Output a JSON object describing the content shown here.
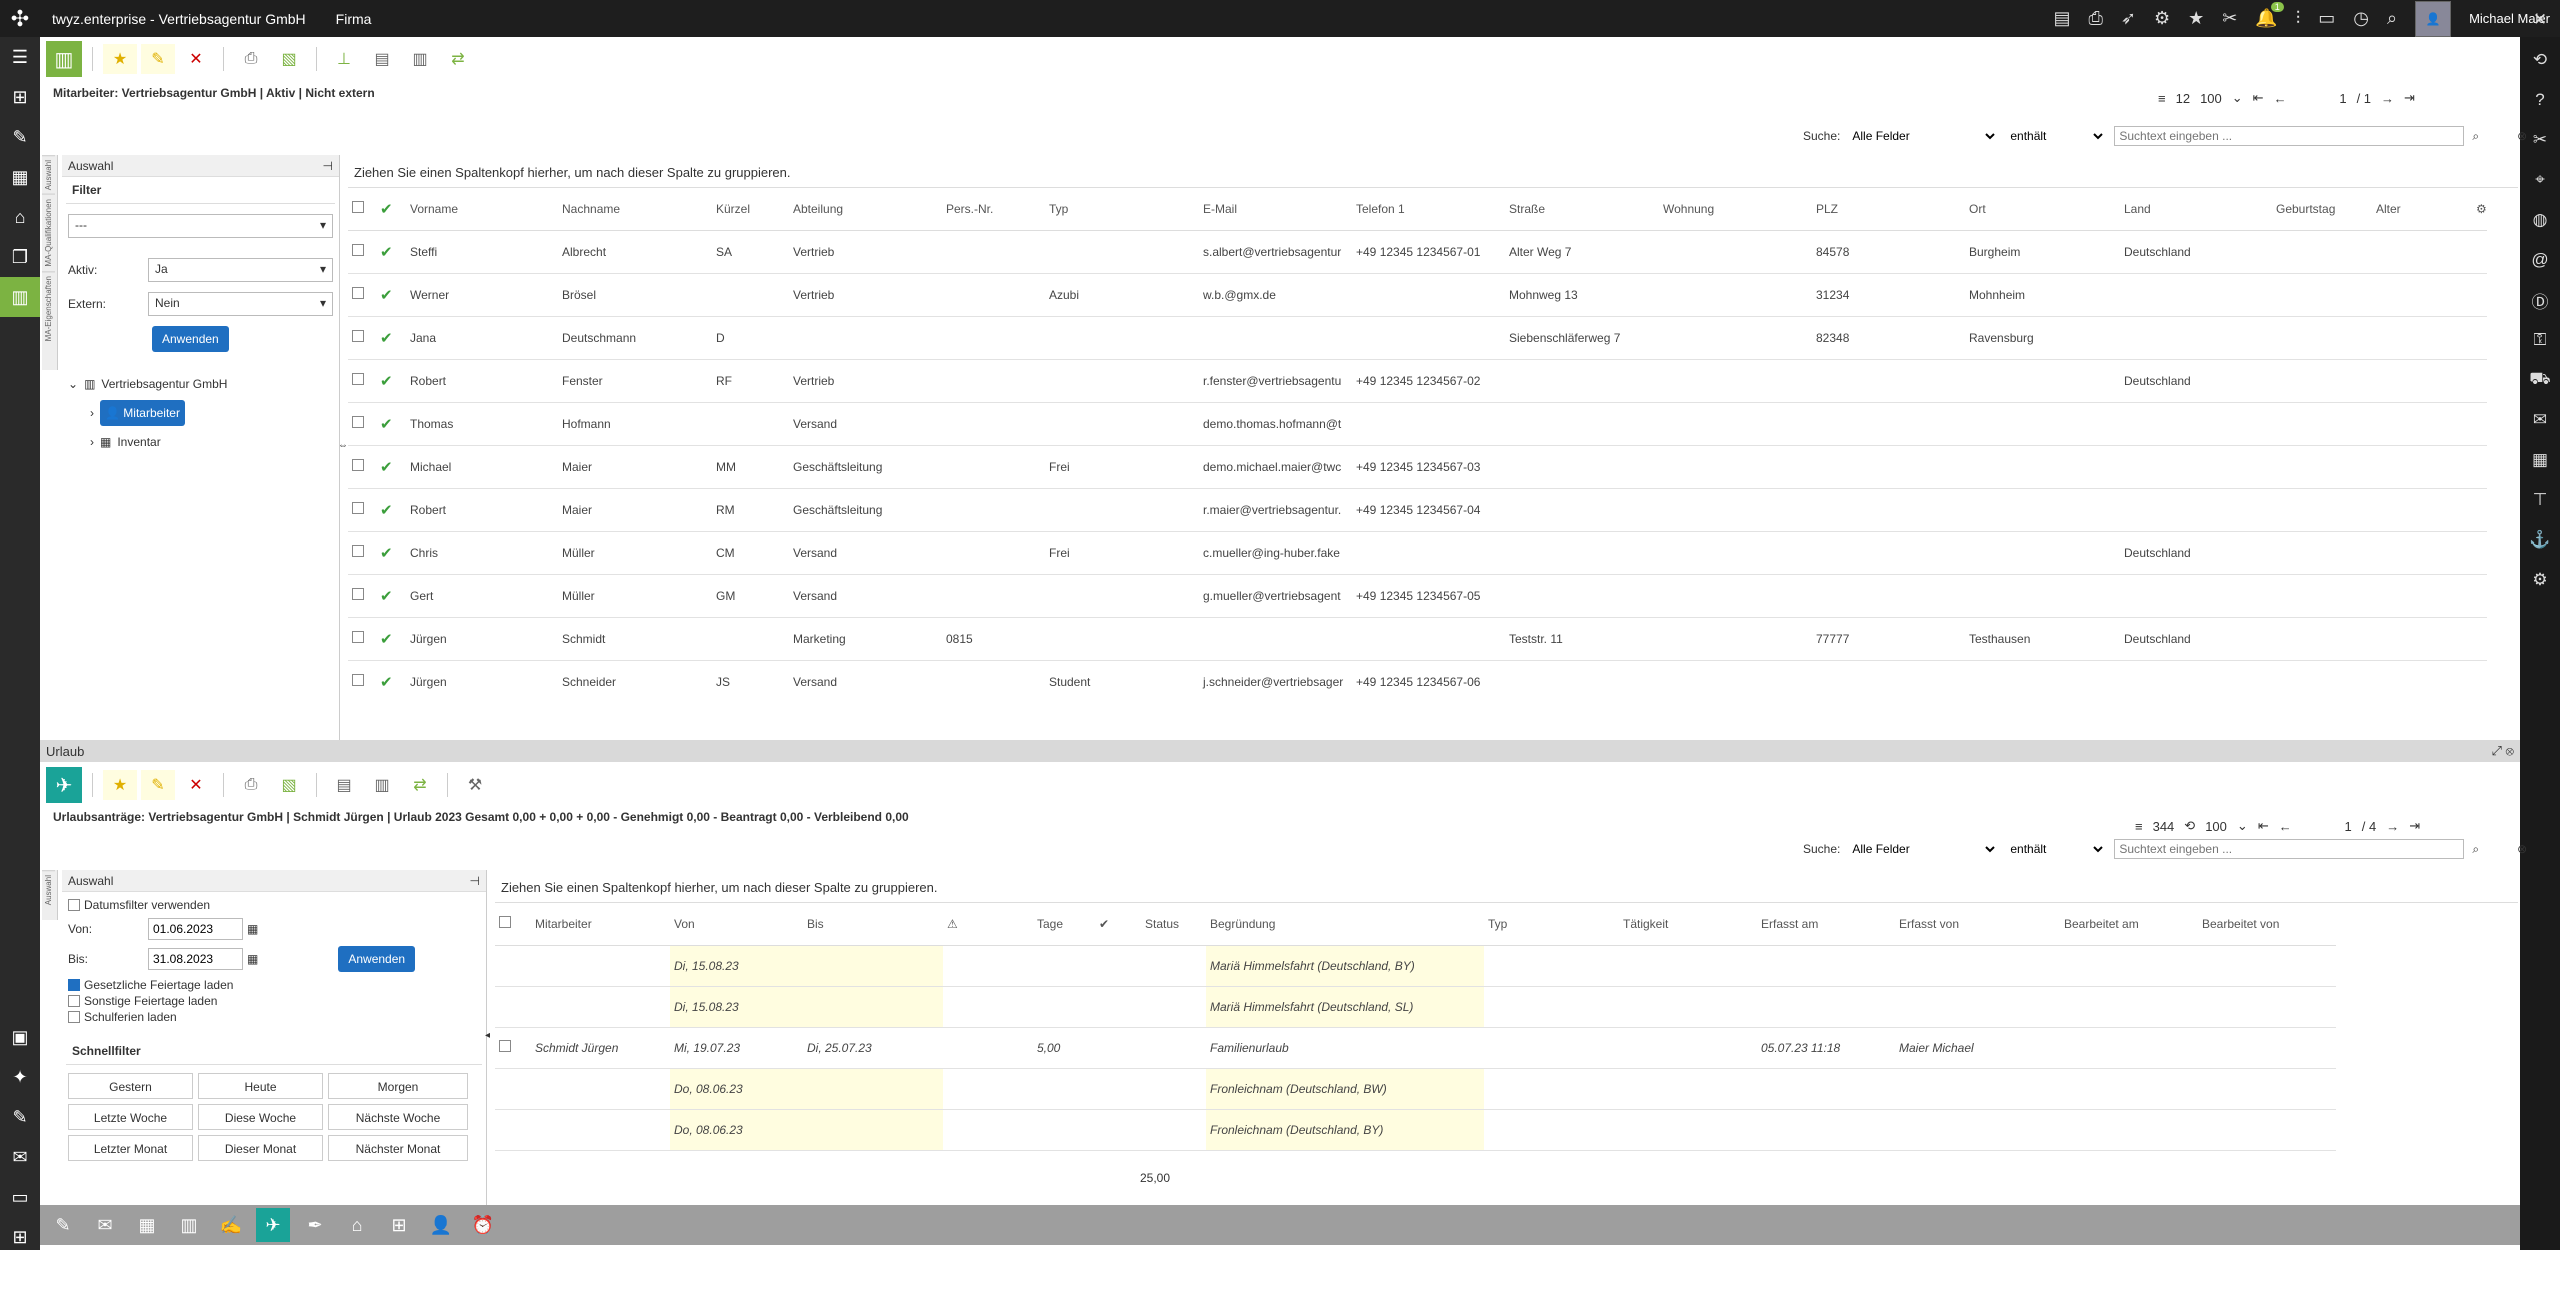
{
  "app": {
    "title": "twyz.enterprise - Vertriebsagentur GmbH",
    "menu": "Firma",
    "user": "Michael Maier",
    "notif_count": "1"
  },
  "top": {
    "breadcrumb": "Mitarbeiter: Vertriebsagentur GmbH | Aktiv | Nicht extern",
    "count": "12",
    "pagesize": "100",
    "page": "1",
    "pages": "/ 1",
    "search_label": "Suche:",
    "search_field": "Alle Felder",
    "search_op": "enthält",
    "search_placeholder": "Suchtext eingeben ...",
    "panel_title": "Auswahl",
    "filter_title": "Filter",
    "filter_preset": "---",
    "aktiv_label": "Aktiv:",
    "aktiv_val": "Ja",
    "extern_label": "Extern:",
    "extern_val": "Nein",
    "apply": "Anwenden",
    "vtabs": [
      "Auswahl",
      "MA-Qualifikationen",
      "MA-Eigenschaften"
    ],
    "tree": {
      "root": "Vertriebsagentur GmbH",
      "child1": "Mitarbeiter",
      "child2": "Inventar"
    },
    "group_hint": "Ziehen Sie einen Spaltenkopf hierher, um nach dieser Spalte zu gruppieren.",
    "columns": [
      "Vorname",
      "Nachname",
      "Kürzel",
      "Abteilung",
      "Pers.-Nr.",
      "Typ",
      "E-Mail",
      "Telefon 1",
      "Straße",
      "Wohnung",
      "PLZ",
      "Ort",
      "Land",
      "Geburtstag",
      "Alter"
    ],
    "rows": [
      [
        "Steffi",
        "Albrecht",
        "SA",
        "Vertrieb",
        "",
        "",
        "s.albert@vertriebsagentur",
        "+49 12345 1234567-01",
        "Alter Weg 7",
        "",
        "84578",
        "Burgheim",
        "Deutschland",
        "",
        ""
      ],
      [
        "Werner",
        "Brösel",
        "",
        "Vertrieb",
        "",
        "Azubi",
        "w.b.@gmx.de",
        "",
        "Mohnweg 13",
        "",
        "31234",
        "Mohnheim",
        "",
        "",
        ""
      ],
      [
        "Jana",
        "Deutschmann",
        "D",
        "",
        "",
        "",
        "",
        "",
        "Siebenschläferweg 7",
        "",
        "82348",
        "Ravensburg",
        "",
        "",
        ""
      ],
      [
        "Robert",
        "Fenster",
        "RF",
        "Vertrieb",
        "",
        "",
        "r.fenster@vertriebsagentu",
        "+49 12345 1234567-02",
        "",
        "",
        "",
        "",
        "Deutschland",
        "",
        ""
      ],
      [
        "Thomas",
        "Hofmann",
        "",
        "Versand",
        "",
        "",
        "demo.thomas.hofmann@t",
        "",
        "",
        "",
        "",
        "",
        "",
        "",
        ""
      ],
      [
        "Michael",
        "Maier",
        "MM",
        "Geschäftsleitung",
        "",
        "Frei",
        "demo.michael.maier@twc",
        "+49 12345 1234567-03",
        "",
        "",
        "",
        "",
        "",
        "",
        ""
      ],
      [
        "Robert",
        "Maier",
        "RM",
        "Geschäftsleitung",
        "",
        "",
        "r.maier@vertriebsagentur.",
        "+49 12345 1234567-04",
        "",
        "",
        "",
        "",
        "",
        "",
        ""
      ],
      [
        "Chris",
        "Müller",
        "CM",
        "Versand",
        "",
        "Frei",
        "c.mueller@ing-huber.fake",
        "",
        "",
        "",
        "",
        "",
        "Deutschland",
        "",
        ""
      ],
      [
        "Gert",
        "Müller",
        "GM",
        "Versand",
        "",
        "",
        "g.mueller@vertriebsagent",
        "+49 12345 1234567-05",
        "",
        "",
        "",
        "",
        "",
        "",
        ""
      ],
      [
        "Jürgen",
        "Schmidt",
        "",
        "Marketing",
        "0815",
        "",
        "",
        "",
        "Teststr. 11",
        "",
        "77777",
        "Testhausen",
        "Deutschland",
        "",
        ""
      ],
      [
        "Jürgen",
        "Schneider",
        "JS",
        "Versand",
        "",
        "Student",
        "j.schneider@vertriebsager",
        "+49 12345 1234567-06",
        "",
        "",
        "",
        "",
        "",
        "",
        ""
      ]
    ]
  },
  "bottom": {
    "title": "Urlaub",
    "breadcrumb": "Urlaubsanträge: Vertriebsagentur GmbH | Schmidt Jürgen | Urlaub 2023 Gesamt 0,00 + 0,00 + 0,00 - Genehmigt 0,00 - Beantragt 0,00 - Verbleibend 0,00",
    "count": "344",
    "pagesize": "100",
    "page": "1",
    "pages": "/ 4",
    "search_label": "Suche:",
    "search_field": "Alle Felder",
    "search_op": "enthält",
    "search_placeholder": "Suchtext eingeben ...",
    "panel_title": "Auswahl",
    "datefilter": "Datumsfilter verwenden",
    "von_label": "Von:",
    "von": "01.06.2023",
    "bis_label": "Bis:",
    "bis": "31.08.2023",
    "apply": "Anwenden",
    "cb1": "Gesetzliche Feiertage laden",
    "cb2": "Sonstige Feiertage laden",
    "cb3": "Schulferien laden",
    "quick_title": "Schnellfilter",
    "quick": [
      "Gestern",
      "Heute",
      "Morgen",
      "Letzte Woche",
      "Diese Woche",
      "Nächste Woche",
      "Letzter Monat",
      "Dieser Monat",
      "Nächster Monat"
    ],
    "vtab": "Auswahl",
    "group_hint": "Ziehen Sie einen Spaltenkopf hierher, um nach dieser Spalte zu gruppieren.",
    "columns": [
      "Mitarbeiter",
      "Von",
      "Bis",
      "⚠",
      "Tage",
      "✔",
      "Status",
      "Begründung",
      "Typ",
      "Tätigkeit",
      "Erfasst am",
      "Erfasst von",
      "Bearbeitet am",
      "Bearbeitet von"
    ],
    "rows": [
      {
        "ma": "",
        "von": "Di, 15.08.23",
        "bis": "",
        "tage": "",
        "status": "",
        "grund": "Mariä Himmelsfahrt (Deutschland, BY)",
        "erf": "",
        "erfv": "",
        "hol": true,
        "cb": false
      },
      {
        "ma": "",
        "von": "Di, 15.08.23",
        "bis": "",
        "tage": "",
        "status": "",
        "grund": "Mariä Himmelsfahrt (Deutschland, SL)",
        "erf": "",
        "erfv": "",
        "hol": true,
        "cb": false
      },
      {
        "ma": "Schmidt Jürgen",
        "von": "Mi, 19.07.23",
        "bis": "Di, 25.07.23",
        "tage": "5,00",
        "status": "",
        "grund": "Familienurlaub",
        "erf": "05.07.23 11:18",
        "erfv": "Maier Michael",
        "hol": false,
        "cb": true
      },
      {
        "ma": "",
        "von": "Do, 08.06.23",
        "bis": "",
        "tage": "",
        "status": "",
        "grund": "Fronleichnam (Deutschland, BW)",
        "erf": "",
        "erfv": "",
        "hol": true,
        "cb": false
      },
      {
        "ma": "",
        "von": "Do, 08.06.23",
        "bis": "",
        "tage": "",
        "status": "",
        "grund": "Fronleichnam (Deutschland, BY)",
        "erf": "",
        "erfv": "",
        "hol": true,
        "cb": false
      }
    ],
    "total": "25,00"
  }
}
